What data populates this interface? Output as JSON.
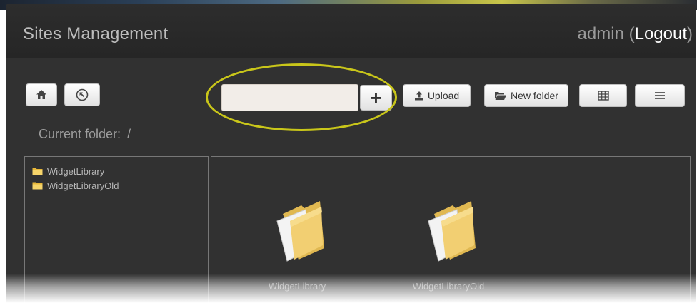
{
  "header": {
    "app_title": "Sites Management",
    "username": "admin",
    "logout_label": "Logout"
  },
  "toolbar": {
    "new_name_value": "",
    "add_label": "+",
    "upload_label": "Upload",
    "new_folder_label": "New folder"
  },
  "location": {
    "current_folder_label": "Current folder:",
    "current_folder_path": "/"
  },
  "tree": {
    "items": [
      {
        "label": "WidgetLibrary",
        "icon": "folder-icon"
      },
      {
        "label": "WidgetLibraryOld",
        "icon": "folder-icon"
      }
    ]
  },
  "files": {
    "items": [
      {
        "label": "WidgetLibrary",
        "icon": "folder-icon"
      },
      {
        "label": "WidgetLibraryOld",
        "icon": "folder-icon"
      }
    ]
  },
  "colors": {
    "background": "#313131",
    "header": "#282828",
    "highlight_ring": "#c9c61a",
    "folder_yellow": "#f0cc6a"
  }
}
